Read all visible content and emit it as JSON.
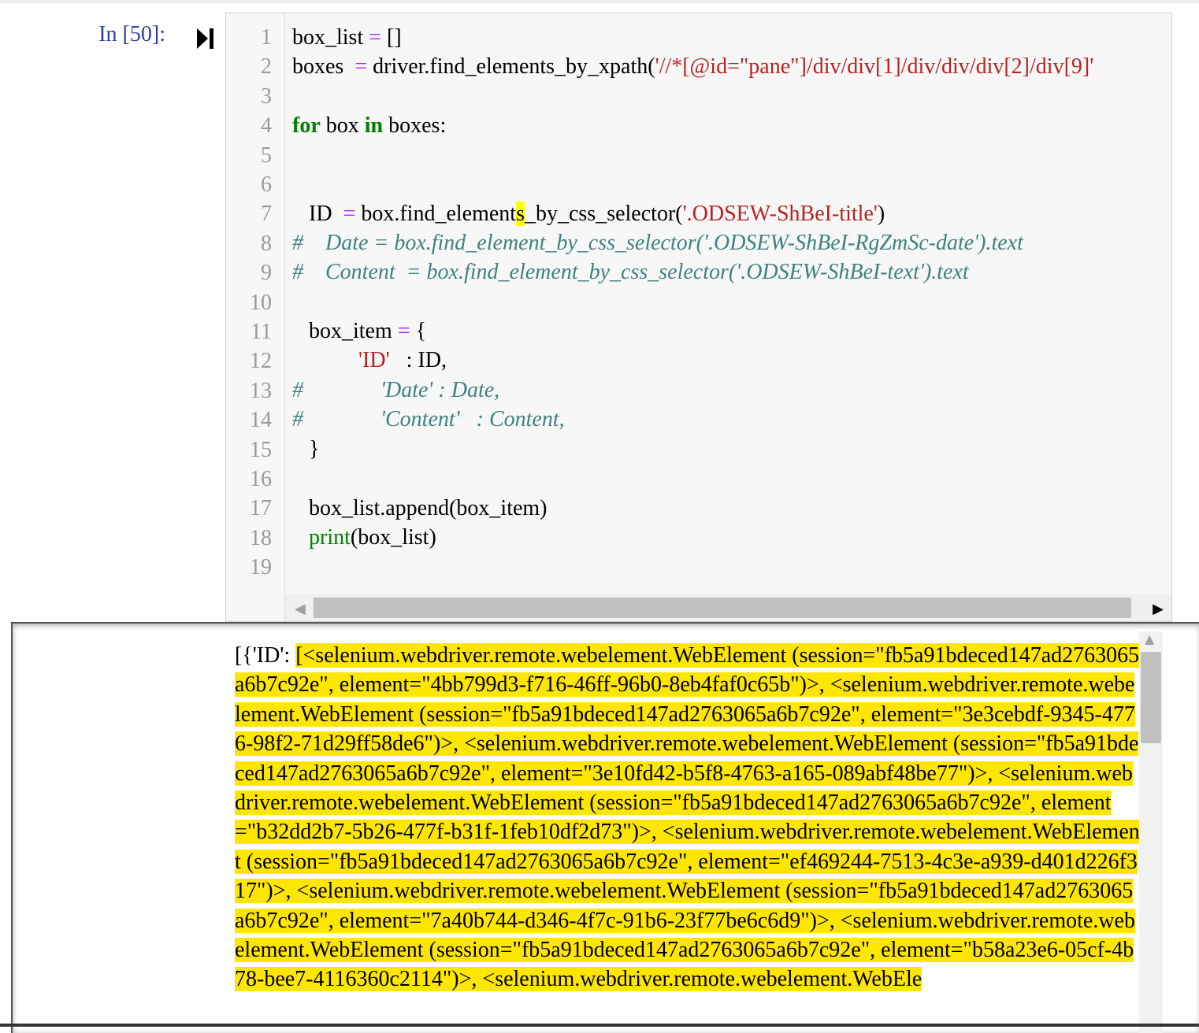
{
  "cell": {
    "prompt": "In [50]:",
    "line_numbers": [
      "1",
      "2",
      "3",
      "4",
      "5",
      "6",
      "7",
      "8",
      "9",
      "10",
      "11",
      "12",
      "13",
      "14",
      "15",
      "16",
      "17",
      "18",
      "19"
    ]
  },
  "code": {
    "l1_a": "box_list ",
    "l1_b": "=",
    "l1_c": " []",
    "l2_a": "boxes ",
    "l2_b": " =",
    "l2_c": " driver.find_elements_by_xpath(",
    "l2_d": "'//*[@id=\"pane\"]/div/div[1]/div/div/div[2]/div[9]'",
    "l4_a": "for",
    "l4_b": " box ",
    "l4_c": "in",
    "l4_d": " boxes:",
    "l7_a": "   ID  ",
    "l7_b": "=",
    "l7_c": " box.find_element",
    "l7_d": "s",
    "l7_e": "_by_css_selector(",
    "l7_f": "'.ODSEW-ShBeI-title'",
    "l7_g": ")",
    "l8": "#    Date = box.find_element_by_css_selector('.ODSEW-ShBeI-RgZmSc-date').text",
    "l9": "#    Content  = box.find_element_by_css_selector('.ODSEW-ShBeI-text').text",
    "l11_a": "   box_item ",
    "l11_b": "=",
    "l11_c": " {",
    "l12_a": "            ",
    "l12_b": "'ID'",
    "l12_c": "   : ID,",
    "l13": "#              'Date' : Date,",
    "l14": "#              'Content'   : Content,",
    "l15": "   }",
    "l17": "   box_list.append(box_item)",
    "l18_a": "   ",
    "l18_b": "print",
    "l18_c": "(box_list)"
  },
  "output": {
    "prefix": "[{'ID': ",
    "highlighted": "[<selenium.webdriver.remote.webelement.WebElement (session=\"fb5a91bdeced147ad2763065a6b7c92e\"",
    "rest_1": ", element=\"4bb799d3-f716-46ff-96b0-8eb4faf0c65b\")>, ",
    "rest_2": "<selenium.webdriver.remote.webelement.WebElement (session=\"fb5a91bdeced147ad2763065a6b7c92e\", element=\"3e3cebdf-9345-4776-98f2-71d29ff58de6\")>, <selenium.webdriver.remote.webelement.WebElement (session=\"fb5a91bdeced147ad2763065a6b7c92e\", element=\"3e10fd42-b5f8-4763-a165-089abf48be77\")>, <selenium.webdriver.remote.webelement.WebElement (session=\"fb5a91bdeced147ad2763065a6b7c92e\", element=\"b32dd2b7-5b26-477f-b31f-1feb10df2d73\")>, <selenium.webdriver.remote.webelement.WebElement (session=\"fb5a91bdeced147ad2763065a6b7c92e\", element=\"ef469244-7513-4c3e-a939-d401d226f317\")>, <selenium.webdriver.remote.webelement.WebElement (session=\"fb5a91bdeced147ad2763065a6b7c92e\", element=\"7a40b744-d346-4f7c-91b6-23f77be6c6d9\")>, <selenium.webdriver.remote.webelement.WebElement (session=\"fb5a91bdeced147ad2763065a6b7c92e\", element=\"b58a23e6-05cf-4b78-bee7-4116360c2114\")>, <selenium.webdriver.remote.webelement.WebEle"
  },
  "colors": {
    "prompt": "#303f9f",
    "highlight": "#ffe600",
    "keyword": "#008000",
    "string": "#ba2121",
    "comment": "#408080"
  },
  "icons": {
    "run": "step-run-icon",
    "scroll_left": "arrow-left-icon",
    "scroll_right": "arrow-right-icon",
    "scroll_up": "arrow-up-icon"
  }
}
